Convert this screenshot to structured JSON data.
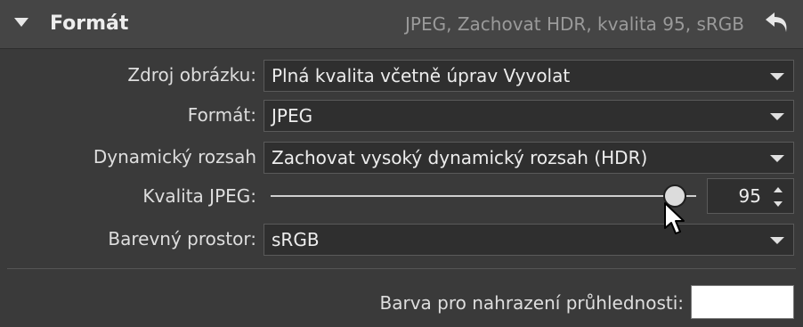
{
  "header": {
    "title": "Formát",
    "summary": "JPEG, Zachovat HDR, kvalita 95, sRGB",
    "collapse_icon": "triangle-down-icon",
    "reset_icon": "undo-arrow-icon"
  },
  "rows": {
    "source": {
      "label": "Zdroj obrázku:",
      "value": "Plná kvalita včetně úprav Vyvolat"
    },
    "format": {
      "label": "Formát:",
      "value": "JPEG"
    },
    "dynamic_range": {
      "label": "Dynamický rozsah",
      "value": "Zachovat vysoký dynamický rozsah (HDR)"
    },
    "jpeg_quality": {
      "label": "Kvalita JPEG:",
      "value": "95",
      "slider_fraction": 0.95
    },
    "color_space": {
      "label": "Barevný prostor:",
      "value": "sRGB"
    }
  },
  "transparency": {
    "label": "Barva pro nahrazení průhlednosti:",
    "color": "#ffffff"
  },
  "colors": {
    "panel_bg": "#3a3a3a",
    "header_bg": "#454545",
    "field_bg": "#2f2f2f"
  }
}
